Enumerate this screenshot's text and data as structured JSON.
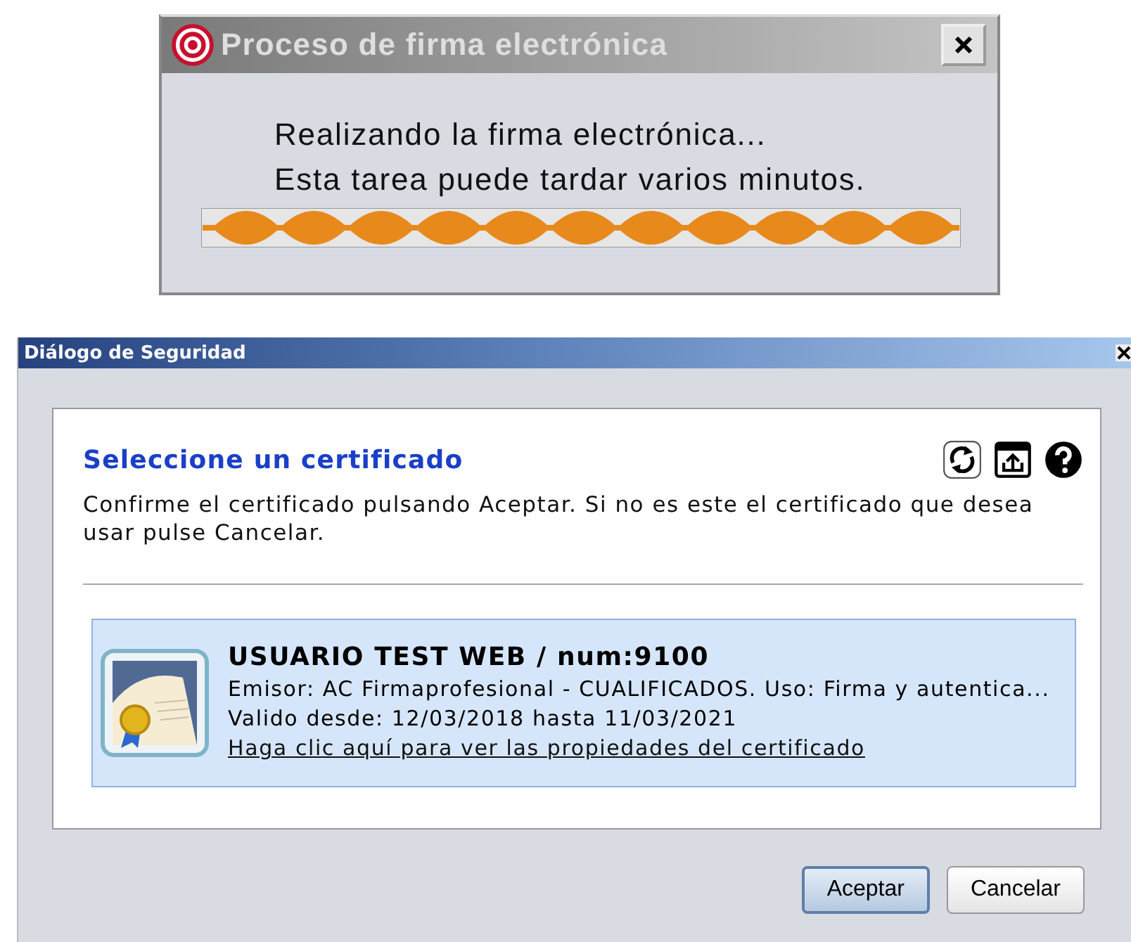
{
  "progress_dialog": {
    "title": "Proceso de firma electrónica",
    "message_lines": [
      "Realizando la firma electrónica...",
      "Esta tarea puede tardar varios minutos."
    ],
    "progress": {
      "indeterminate": true
    }
  },
  "security_dialog": {
    "title": "Diálogo de Seguridad",
    "heading": "Seleccione un certificado",
    "instructions": "Confirme el certificado pulsando Aceptar. Si no es este el certificado que desea usar pulse Cancelar.",
    "certificates": [
      {
        "name": "USUARIO TEST WEB / num:9100",
        "issuer": "Emisor: AC Firmaprofesional - CUALIFICADOS. Uso: Firma y autentica...",
        "validity": "Valido desde: 12/03/2018 hasta 11/03/2021",
        "link": "Haga clic aquí para ver las propiedades del certificado",
        "selected": true
      }
    ],
    "buttons": [
      {
        "label": "Aceptar",
        "default": true
      },
      {
        "label": "Cancelar",
        "default": false
      }
    ]
  }
}
